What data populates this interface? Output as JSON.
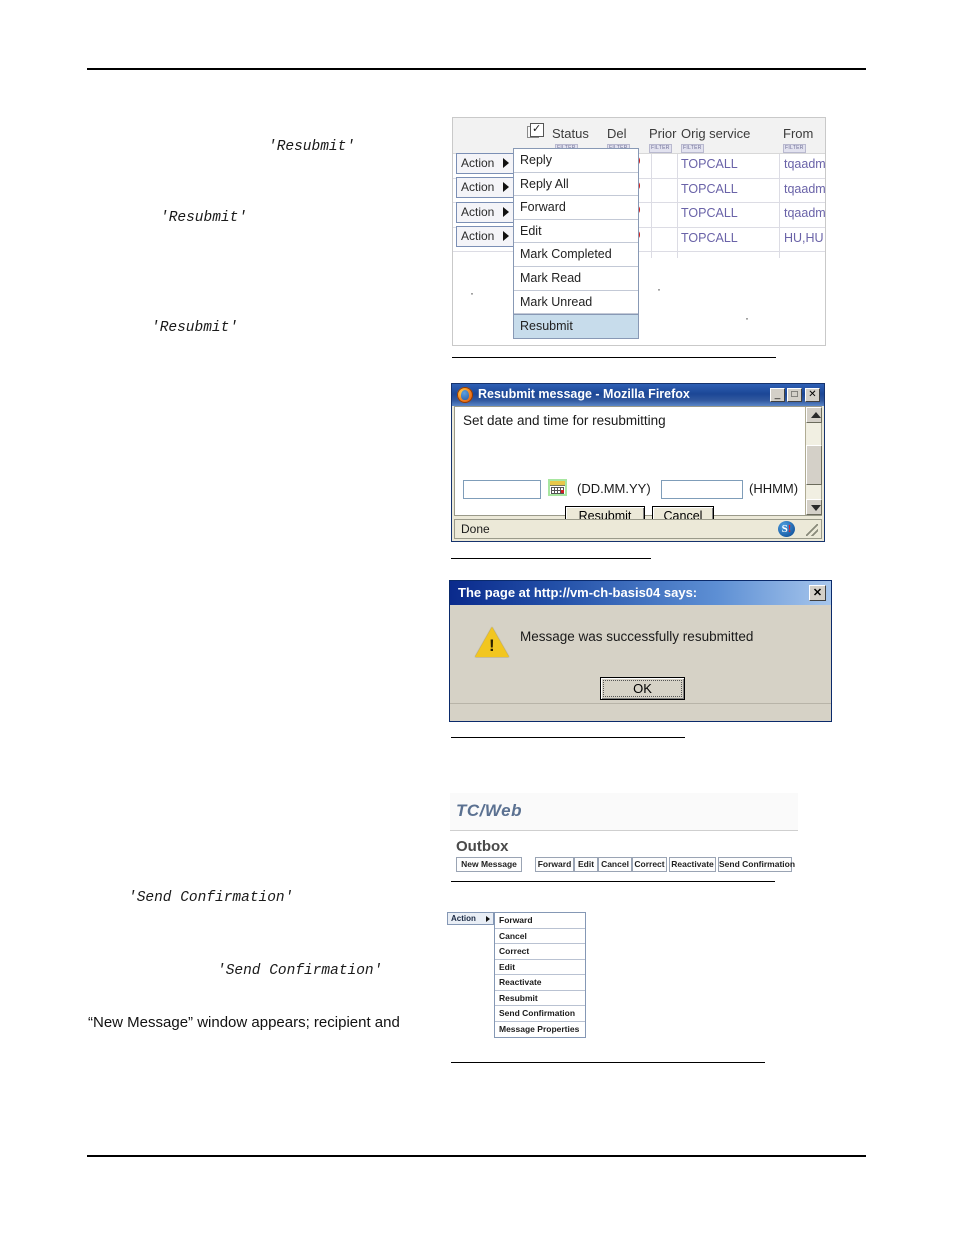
{
  "page": {
    "header_rule": true,
    "footer_rule": true
  },
  "left_column": {
    "notes": [
      {
        "text": "'Resubmit'",
        "style": "mono"
      },
      {
        "text": "'Resubmit'",
        "style": "mono"
      },
      {
        "text": "'Resubmit'",
        "style": "mono"
      },
      {
        "text": "'Send Confirmation'",
        "style": "mono"
      },
      {
        "text": "'Send Confirmation'",
        "style": "mono"
      },
      {
        "text": "“New Message” window appears; recipient and",
        "style": "body"
      }
    ]
  },
  "figure_message_list": {
    "columns": [
      {
        "label": "",
        "filter": "FILTER"
      },
      {
        "label": "Status",
        "filter": "FILTER"
      },
      {
        "label": "Del",
        "filter": "FILTER"
      },
      {
        "label": "Prior",
        "filter": "FILTER"
      },
      {
        "label": "Orig service",
        "filter": "FILTER"
      },
      {
        "label": "From",
        "filter": "FILTER"
      }
    ],
    "select_all_icon": "checkbox-stack-icon",
    "rows": [
      {
        "action_label": "Action",
        "priority": "high",
        "orig_service": "TOPCALL",
        "from": "tqaadm"
      },
      {
        "action_label": "Action",
        "priority": "high",
        "orig_service": "TOPCALL",
        "from": "tqaadm"
      },
      {
        "action_label": "Action",
        "priority": "high",
        "orig_service": "TOPCALL",
        "from": "tqaadm"
      },
      {
        "action_label": "Action",
        "priority": "high",
        "orig_service": "TOPCALL",
        "from": "HU,HU"
      }
    ],
    "menu": {
      "items": [
        {
          "label": "Reply",
          "selected": false
        },
        {
          "label": "Reply All",
          "selected": false
        },
        {
          "label": "Forward",
          "selected": false
        },
        {
          "label": "Edit",
          "selected": false
        },
        {
          "label": "Mark Completed",
          "selected": false
        },
        {
          "label": "Mark Read",
          "selected": false
        },
        {
          "label": "Mark Unread",
          "selected": false
        },
        {
          "label": "Resubmit",
          "selected": true
        }
      ]
    }
  },
  "figure_resubmit_dialog": {
    "title": "Resubmit message - Mozilla Firefox",
    "app_icon": "firefox-icon",
    "window_buttons": {
      "minimize": "_",
      "maximize": "□",
      "close": "✕"
    },
    "prompt": "Set date and time for resubmitting",
    "date_field": {
      "value": "",
      "placeholder": ""
    },
    "date_hint": "(DD.MM.YY)",
    "calendar_icon": "calendar-picker-icon",
    "time_field": {
      "value": "",
      "placeholder": ""
    },
    "time_hint": "(HHMM)",
    "buttons": {
      "submit": "Resubmit",
      "cancel": "Cancel"
    },
    "status": "Done",
    "status_icon": "skype-s-icon",
    "status_icon_text": "S",
    "status_icon_mark": "!",
    "scrollbar": {
      "up": "▲",
      "down": "▼"
    }
  },
  "figure_alert": {
    "title": "The page at http://vm-ch-basis04 says:",
    "close_label": "✕",
    "icon": "warning-triangle-icon",
    "message": "Message was successfully resubmitted",
    "ok_label": "OK"
  },
  "figure_tcweb": {
    "brand": "TC/Web",
    "folder": "Outbox",
    "primary_button": "New Message",
    "toolbar_buttons": [
      "Forward",
      "Edit",
      "Cancel",
      "Correct",
      "Reactivate",
      "Send Confirmation"
    ]
  },
  "figure_action_menu": {
    "trigger_label": "Action",
    "items": [
      "Forward",
      "Cancel",
      "Correct",
      "Edit",
      "Reactivate",
      "Resubmit",
      "Send Confirmation",
      "Message Properties"
    ]
  },
  "colors": {
    "link_purple": "#6a63a8",
    "priority_red": "#cc2222",
    "menu_selected": "#c7dceb",
    "title_blue": "#1c4796",
    "brand_slate": "#5b7191",
    "warning_yellow": "#f2c620"
  }
}
